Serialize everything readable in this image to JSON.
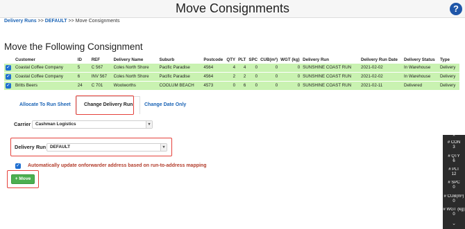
{
  "header": {
    "title": "Move Consignments",
    "help_icon": "?"
  },
  "breadcrumb": {
    "item1": "Delivery Runs",
    "sep1": ">>",
    "item2": "DEFAULT",
    "sep2": ">>",
    "item3": "Move Consignments"
  },
  "section_heading": "Move the Following Consignment",
  "table": {
    "columns": [
      "",
      "Customer",
      "ID",
      "REF",
      "Delivery Name",
      "Suburb",
      "Postcode",
      "QTY",
      "PLT",
      "SPC",
      "CUB(m³)",
      "WGT (kg)",
      "Delivery Run",
      "Delivery Run Date",
      "Delivery Status",
      "Type"
    ],
    "rows": [
      [
        "",
        "Coastal Coffee Company",
        "5",
        "C 567",
        "Coles North Shore",
        "Pacific Paradise",
        "4564",
        "4",
        "4",
        "0",
        "0",
        "0",
        "SUNSHINE COAST RUN",
        "2021-02-02",
        "In Warehouse",
        "Delivery"
      ],
      [
        "",
        "Coastal Coffee Company",
        "6",
        "INV 567",
        "Coles North Shore",
        "Pacific Paradise",
        "4564",
        "2",
        "2",
        "0",
        "0",
        "0",
        "SUNSHINE COAST RUN",
        "2021-02-02",
        "In Warehouse",
        "Delivery"
      ],
      [
        "",
        "Britts Beers",
        "24",
        "C 701",
        "Woolworths",
        "COOLUM BEACH",
        "4573",
        "0",
        "6",
        "0",
        "0",
        "0",
        "SUNSHINE COAST RUN",
        "2021-02-11",
        "Delivered",
        "Delivery"
      ]
    ]
  },
  "tabs": {
    "allocate": "Allocate To Run Sheet",
    "change_run": "Change Delivery Run",
    "change_date": "Change Date Only"
  },
  "carrier": {
    "label": "Carrier",
    "value": "Cashman Logistics"
  },
  "delivery_run": {
    "label": "Delivery Run",
    "value": "DEFAULT"
  },
  "auto_update": {
    "checked": true,
    "label": "Automatically update onforwarder address based on run-to-address mapping"
  },
  "move_button": {
    "label": "Move",
    "icon": "plus-icon",
    "color": "#4caf50"
  },
  "summary": [
    {
      "label": "# CON",
      "value": "3"
    },
    {
      "label": "# QTY",
      "value": "6"
    },
    {
      "label": "# PLT",
      "value": "12"
    },
    {
      "label": "# SPC",
      "value": "0"
    },
    {
      "label": "# CUB(m³)",
      "value": "0"
    },
    {
      "label": "# WGT (kg)",
      "value": "0"
    }
  ],
  "colors": {
    "row_highlight": "#c9f2b1",
    "link": "#1a63b5",
    "annotation": "#e5403a",
    "summary_bg": "#2b2b2b"
  }
}
